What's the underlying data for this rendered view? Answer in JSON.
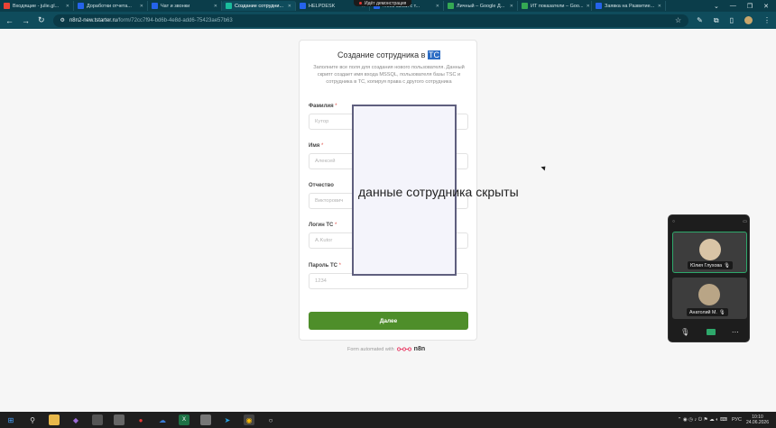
{
  "browser": {
    "tabs": [
      {
        "label": "Входящие - julie.gl...",
        "color": "#ea4335"
      },
      {
        "label": "Доработки отчета...",
        "color": "#2563eb"
      },
      {
        "label": "Чат и звонки",
        "color": "#2563eb"
      },
      {
        "label": "Создание сотрудни...",
        "color": "#1abc9c",
        "active": true
      },
      {
        "label": "HELPDESK",
        "color": "#2563eb"
      },
      {
        "label": "...еез связи с т...",
        "color": "#2563eb"
      },
      {
        "label": "Личный – Google Д...",
        "color": "#34a853"
      },
      {
        "label": "ИТ показатели – Goo...",
        "color": "#34a853"
      },
      {
        "label": "Заявка на Развитие...",
        "color": "#2563eb"
      }
    ],
    "demo_pill": "Идёт демонстрация",
    "url_host": "n8n2-new.tstarter.ru",
    "url_path": "/form/72cc7f94-bd6b-4e8d-add6-75423ae57b63"
  },
  "form": {
    "title_prefix": "Создание сотрудника в ",
    "title_highlight": "ТС",
    "description": "Заполните все поля для создания нового пользователя. Данный скрипт создает имя входа MSSQL, пользователя базы TSC и сотрудника в ТС, копируя права с другого сотрудника",
    "fields": [
      {
        "label": "Фамилия",
        "required": "*",
        "placeholder": "Кутор"
      },
      {
        "label": "Имя",
        "required": "*",
        "placeholder": "Алексей"
      },
      {
        "label": "Отчество",
        "required": "",
        "placeholder": "Викторович"
      },
      {
        "label": "Логин ТС",
        "required": "*",
        "placeholder": "A.Kutor"
      },
      {
        "label": "Пароль ТС",
        "required": "*",
        "placeholder": "1234"
      }
    ],
    "submit_label": "Далее",
    "footer_text": "Form automated with",
    "footer_brand": "n8n"
  },
  "redaction": {
    "caption": "данные сотрудника скрыты"
  },
  "videocall": {
    "participants": [
      {
        "name": "Юлия Глухова",
        "speaking": true
      },
      {
        "name": "Анатолий М.",
        "speaking": false
      }
    ]
  },
  "taskbar": {
    "lang": "РУС",
    "time": "10:10",
    "date": "24.06.2026"
  }
}
